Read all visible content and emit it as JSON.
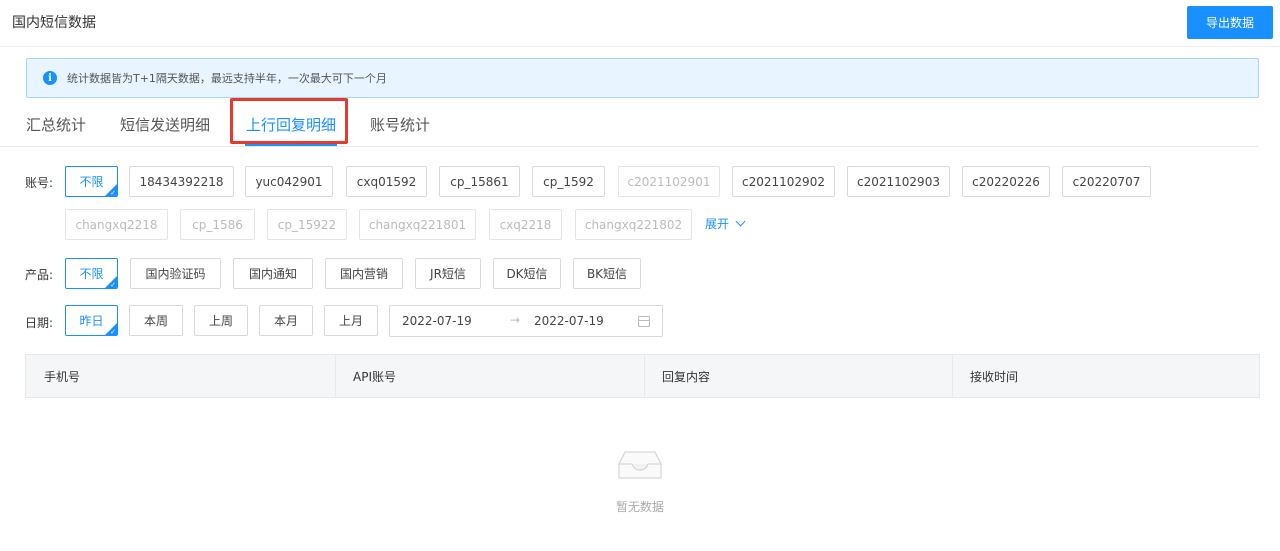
{
  "header": {
    "title": "国内短信数据",
    "export_label": "导出数据"
  },
  "notice": {
    "icon": "info-icon",
    "text": "统计数据皆为T+1隔天数据，最远支持半年，一次最大可下一个月"
  },
  "tabs": [
    {
      "label": "汇总统计",
      "active": false
    },
    {
      "label": "短信发送明细",
      "active": false
    },
    {
      "label": "上行回复明细",
      "active": true
    },
    {
      "label": "账号统计",
      "active": false
    }
  ],
  "filters": {
    "account": {
      "label": "账号:",
      "options": [
        {
          "label": "不限",
          "selected": true
        },
        {
          "label": "18434392218"
        },
        {
          "label": "yuc042901"
        },
        {
          "label": "cxq01592"
        },
        {
          "label": "cp_15861"
        },
        {
          "label": "cp_1592"
        },
        {
          "label": "c2021102901",
          "disabled": true
        },
        {
          "label": "c2021102902"
        },
        {
          "label": "c2021102903"
        },
        {
          "label": "c20220226"
        },
        {
          "label": "c20220707"
        },
        {
          "label": "changxq2218",
          "disabled": true
        },
        {
          "label": "cp_1586",
          "disabled": true
        },
        {
          "label": "cp_15922",
          "disabled": true
        },
        {
          "label": "changxq221801",
          "disabled": true
        },
        {
          "label": "cxq2218",
          "disabled": true
        },
        {
          "label": "changxq221802",
          "disabled": true
        }
      ],
      "expand_label": "展开"
    },
    "product": {
      "label": "产品:",
      "options": [
        {
          "label": "不限",
          "selected": true
        },
        {
          "label": "国内验证码"
        },
        {
          "label": "国内通知"
        },
        {
          "label": "国内营销"
        },
        {
          "label": "JR短信"
        },
        {
          "label": "DK短信"
        },
        {
          "label": "BK短信"
        }
      ]
    },
    "date": {
      "label": "日期:",
      "options": [
        {
          "label": "昨日",
          "selected": true
        },
        {
          "label": "本周"
        },
        {
          "label": "上周"
        },
        {
          "label": "本月"
        },
        {
          "label": "上月"
        }
      ],
      "range_start": "2022-07-19",
      "range_separator": "→",
      "range_end": "2022-07-19"
    }
  },
  "table": {
    "columns": [
      "手机号",
      "API账号",
      "回复内容",
      "接收时间"
    ],
    "rows": [],
    "empty_text": "暂无数据"
  },
  "colors": {
    "accent": "#1890ff",
    "highlight": "#e63a2e",
    "notice_bg": "#e8f4ff"
  }
}
